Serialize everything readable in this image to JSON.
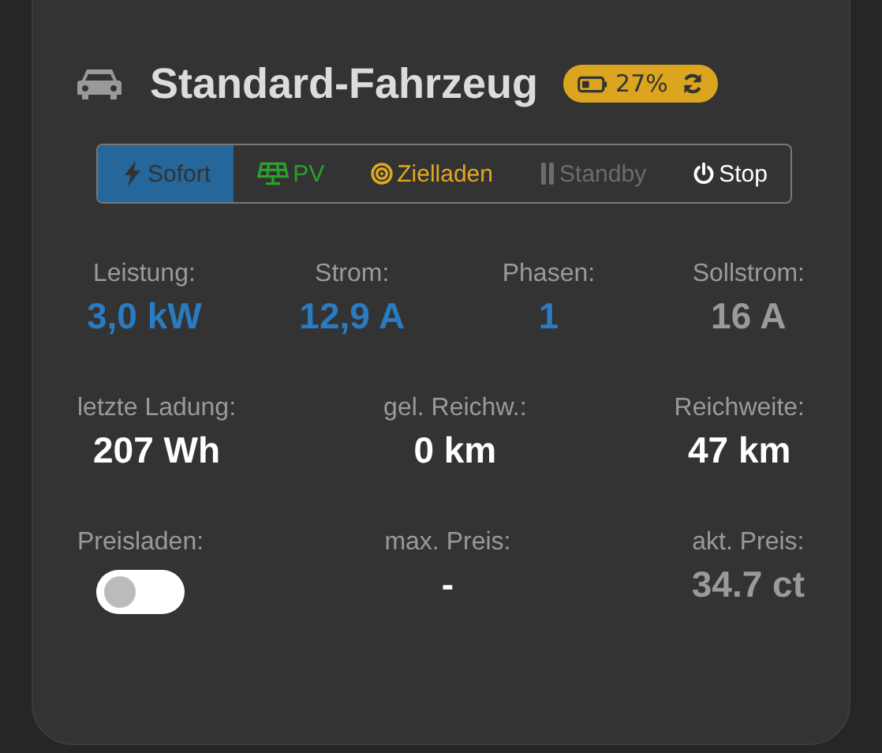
{
  "title": "Standard-Fahrzeug",
  "badge": {
    "text": "27%"
  },
  "modes": [
    {
      "label": "Sofort",
      "kind": "bolt",
      "color": "#333333",
      "selected": true
    },
    {
      "label": "PV",
      "kind": "solar",
      "color": "#2ca02c",
      "selected": false
    },
    {
      "label": "Zielladen",
      "kind": "target",
      "color": "#e0a820",
      "selected": false
    },
    {
      "label": "Standby",
      "kind": "pause",
      "color": "#6c6c6c",
      "selected": false
    },
    {
      "label": "Stop",
      "kind": "power",
      "color": "#ffffff",
      "selected": false
    }
  ],
  "rows": [
    [
      {
        "label": "Leistung:",
        "value": "3,0 kW",
        "color": "#2a7bc0"
      },
      {
        "label": "Strom:",
        "value": "12,9 A",
        "color": "#2a7bc0"
      },
      {
        "label": "Phasen:",
        "value": "1",
        "color": "#2a7bc0"
      },
      {
        "label": "Sollstrom:",
        "value": "16 A",
        "color": "#9a9a9a"
      }
    ],
    [
      {
        "label": "letzte Ladung:",
        "value": "207 Wh",
        "color": "#ffffff"
      },
      {
        "label": "gel. Reichw.:",
        "value": "0 km",
        "color": "#ffffff"
      },
      {
        "label": "Reichweite:",
        "value": "47 km",
        "color": "#ffffff"
      }
    ],
    [
      {
        "label": "Preisladen:",
        "kind": "toggle",
        "checked": false
      },
      {
        "label": "max. Preis:",
        "value": "-",
        "color": "#ffffff"
      },
      {
        "label": "akt. Preis:",
        "value": "34.7 ct",
        "color": "#9a9a9a"
      }
    ]
  ]
}
